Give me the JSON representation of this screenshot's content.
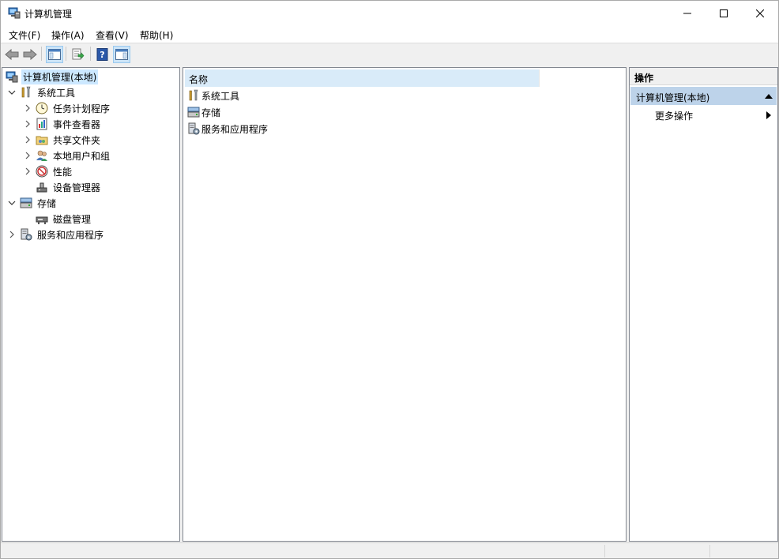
{
  "window": {
    "title": "计算机管理",
    "icon": "computer-management-icon"
  },
  "menu": [
    "文件(F)",
    "操作(A)",
    "查看(V)",
    "帮助(H)"
  ],
  "toolbar": {
    "buttons": [
      "back-icon",
      "forward-icon",
      "show-hide-console-tree-icon",
      "export-list-icon",
      "help-icon",
      "show-hide-action-pane-icon"
    ]
  },
  "tree": {
    "root": "计算机管理(本地)",
    "system_tools": "系统工具",
    "task_scheduler": "任务计划程序",
    "event_viewer": "事件查看器",
    "shared_folders": "共享文件夹",
    "local_users": "本地用户和组",
    "performance": "性能",
    "device_manager": "设备管理器",
    "storage": "存储",
    "disk_management": "磁盘管理",
    "services_apps": "服务和应用程序"
  },
  "list": {
    "column_name": "名称",
    "rows": [
      "系统工具",
      "存储",
      "服务和应用程序"
    ]
  },
  "actions": {
    "header": "操作",
    "group": "计算机管理(本地)",
    "more": "更多操作"
  },
  "colors": {
    "selection": "#cce8ff",
    "header_blue": "#d9ebf9",
    "action_group": "#bdd3ea"
  }
}
